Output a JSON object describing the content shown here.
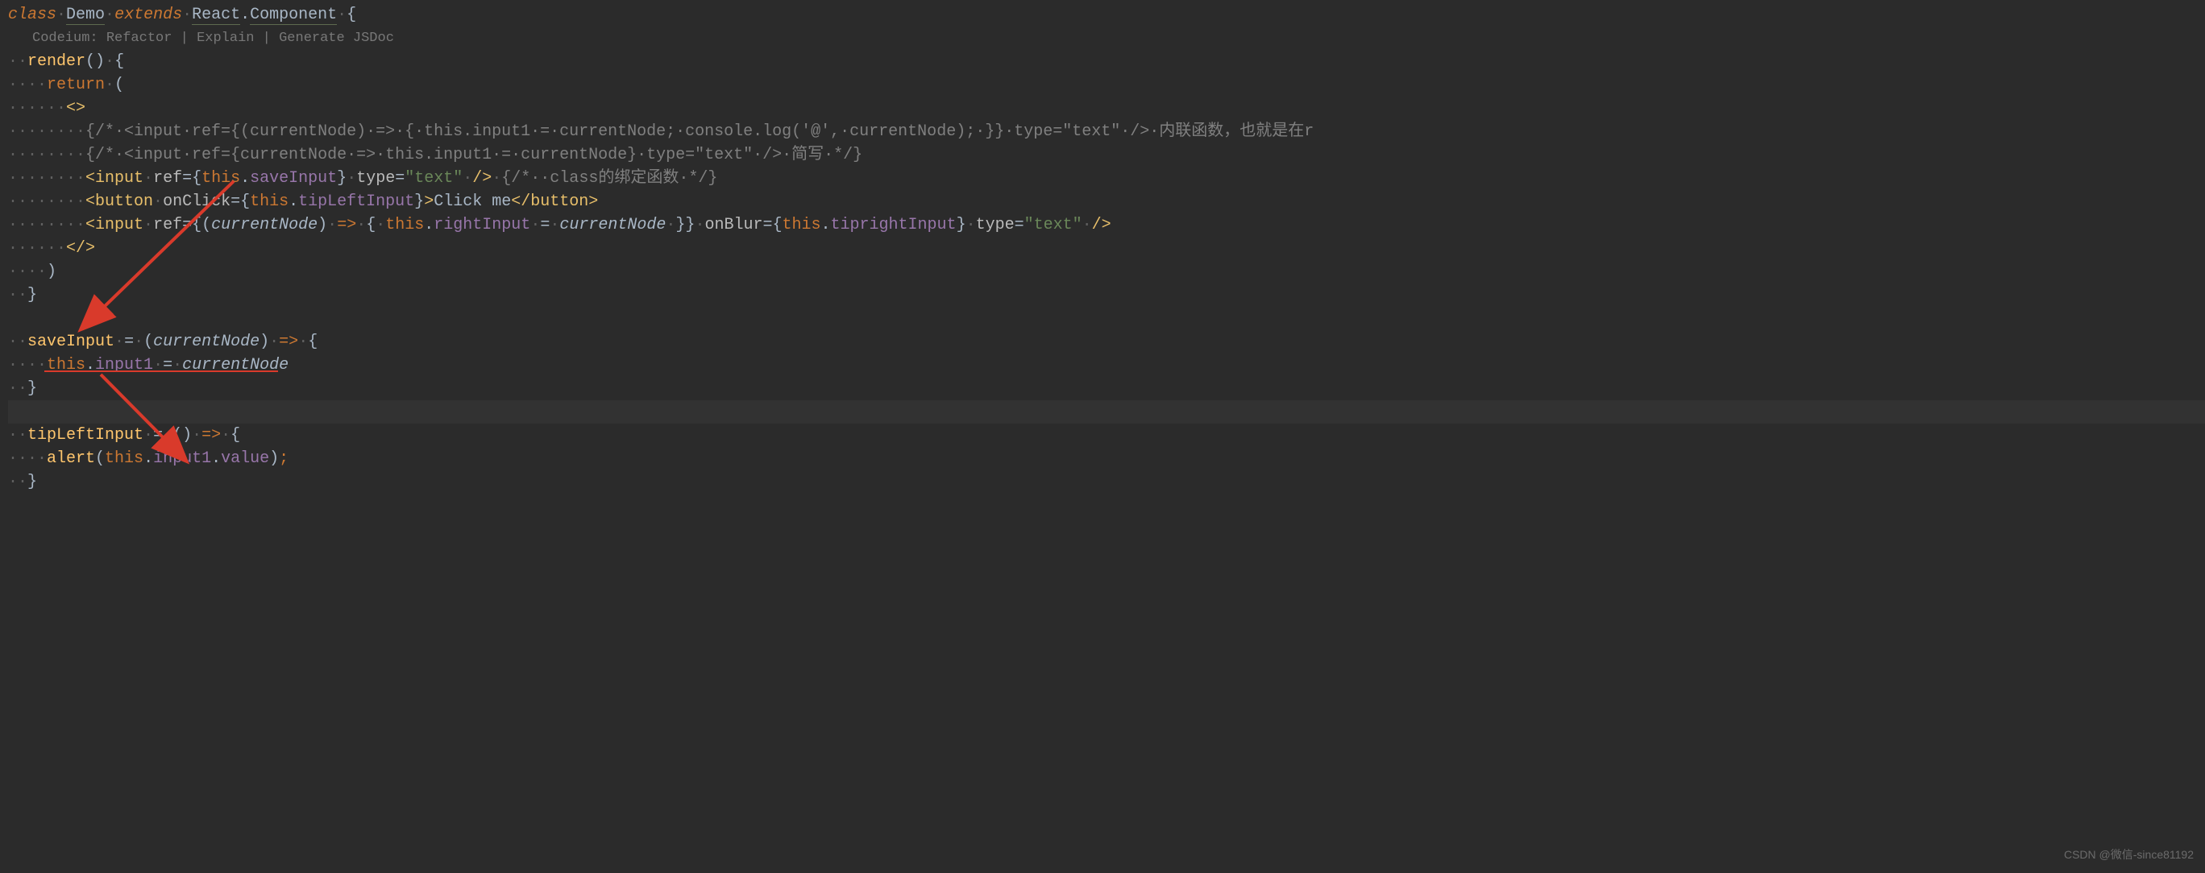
{
  "codelens": {
    "prefix": "Codeium: ",
    "items": [
      "Refactor",
      "Explain",
      "Generate JSDoc"
    ],
    "sep": " | "
  },
  "code": {
    "l1_dots": "",
    "l1_class": "class",
    "l1_d1": "·",
    "l1_demo": "Demo",
    "l1_d2": "·",
    "l1_extends": "extends",
    "l1_d3": "·",
    "l1_react": "React",
    "l1_dot": ".",
    "l1_component": "Component",
    "l1_d4": "·",
    "l1_brace": "{",
    "l3_dots": "··",
    "l3_render": "render",
    "l3_parens": "()",
    "l3_d1": "·",
    "l3_brace": "{",
    "l4_dots": "····",
    "l4_return": "return",
    "l4_d1": "·",
    "l4_paren": "(",
    "l5_dots": "······",
    "l5_frag": "<>",
    "l6_dots": "········",
    "l6_comment": "{/*·<input·ref={(currentNode)·=>·{·this.input1·=·currentNode;·console.log('@',·currentNode);·}}·type=\"text\"·/>·内联函数，也就是在r",
    "l7_dots": "········",
    "l7_comment": "{/*·<input·ref={currentNode·=>·this.input1·=·currentNode}·type=\"text\"·/>·简写·*/}",
    "l8_dots": "········",
    "l8_lt": "<",
    "l8_input": "input",
    "l8_d1": "·",
    "l8_ref": "ref",
    "l8_eq": "=",
    "l8_bo": "{",
    "l8_this": "this",
    "l8_dot": ".",
    "l8_save": "saveInput",
    "l8_bc": "}",
    "l8_d2": "·",
    "l8_type": "type",
    "l8_eq2": "=",
    "l8_str": "\"text\"",
    "l8_d3": "·",
    "l8_close": "/>",
    "l8_d4": "·",
    "l8_comment": "{/*··class的绑定函数·*/}",
    "l9_dots": "········",
    "l9_lt": "<",
    "l9_button": "button",
    "l9_d1": "·",
    "l9_onclick": "onClick",
    "l9_eq": "=",
    "l9_bo": "{",
    "l9_this": "this",
    "l9_dot": ".",
    "l9_tip": "tipLeftInput",
    "l9_bc": "}",
    "l9_gt": ">",
    "l9_text": "Click me",
    "l9_lt2": "</",
    "l9_button2": "button",
    "l9_gt2": ">",
    "l10_dots": "········",
    "l10_lt": "<",
    "l10_input": "input",
    "l10_d1": "·",
    "l10_ref": "ref",
    "l10_eq": "=",
    "l10_bo": "{",
    "l10_po": "(",
    "l10_cn": "currentNode",
    "l10_pc": ")",
    "l10_d2": "·",
    "l10_arrow": "=>",
    "l10_d3": "·",
    "l10_bo2": "{",
    "l10_d4": "·",
    "l10_this": "this",
    "l10_dot": ".",
    "l10_right": "rightInput",
    "l10_d5": "·",
    "l10_eq2": "=",
    "l10_d6": "·",
    "l10_cn2": "currentNode",
    "l10_d7": "·",
    "l10_bc2": "}",
    "l10_bc": "}",
    "l10_d8": "·",
    "l10_onblur": "onBlur",
    "l10_eq3": "=",
    "l10_bo3": "{",
    "l10_this2": "this",
    "l10_dot2": ".",
    "l10_tipright": "tiprightInput",
    "l10_bc3": "}",
    "l10_d9": "·",
    "l10_type": "type",
    "l10_eq4": "=",
    "l10_str": "\"text\"",
    "l10_d10": "·",
    "l10_close": "/>",
    "l11_dots": "······",
    "l11_frag": "</>",
    "l12_dots": "····",
    "l12_paren": ")",
    "l13_dots": "··",
    "l13_brace": "}",
    "l14_empty": "",
    "l15_dots": "··",
    "l15_save": "saveInput",
    "l15_d1": "·",
    "l15_eq": "=",
    "l15_d2": "·",
    "l15_po": "(",
    "l15_cn": "currentNode",
    "l15_pc": ")",
    "l15_d3": "·",
    "l15_arrow": "=>",
    "l15_d4": "·",
    "l15_brace": "{",
    "l16_dots": "····",
    "l16_this": "this",
    "l16_dot": ".",
    "l16_input1": "input1",
    "l16_d1": "·",
    "l16_eq": "=",
    "l16_d2": "·",
    "l16_cn": "currentNode",
    "l17_dots": "··",
    "l17_brace": "}",
    "l19_dots": "··",
    "l19_tip": "tipLeftInput",
    "l19_d1": "·",
    "l19_eq": "=",
    "l19_d2": "·",
    "l19_po": "(",
    "l19_pc": ")",
    "l19_d3": "·",
    "l19_arrow": "=>",
    "l19_d4": "·",
    "l19_brace": "{",
    "l20_dots": "····",
    "l20_alert": "alert",
    "l20_po": "(",
    "l20_this": "this",
    "l20_dot": ".",
    "l20_input1": "input1",
    "l20_dot2": ".",
    "l20_value": "value",
    "l20_pc": ")",
    "l20_semi": ";",
    "l21_dots": "··",
    "l21_brace": "}"
  },
  "watermark": "CSDN @微信-since81192"
}
